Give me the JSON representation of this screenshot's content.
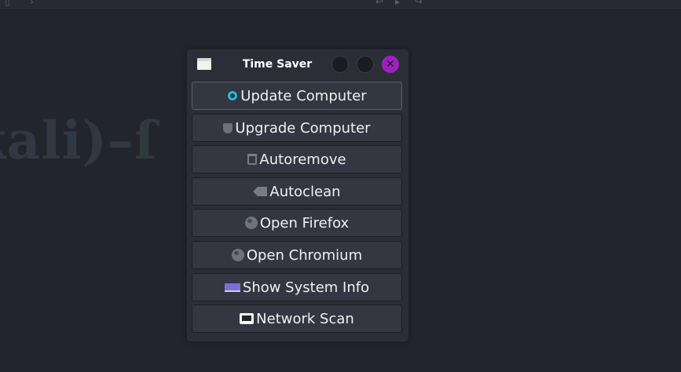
{
  "window": {
    "title": "Time Saver",
    "close_glyph": "✕"
  },
  "buttons": [
    {
      "label": "Update Computer",
      "icon": "update-icon"
    },
    {
      "label": "Upgrade Computer",
      "icon": "shield-icon"
    },
    {
      "label": "Autoremove",
      "icon": "trash-icon"
    },
    {
      "label": "Autoclean",
      "icon": "eraser-icon"
    },
    {
      "label": "Open Firefox",
      "icon": "globe-icon"
    },
    {
      "label": "Open Chromium",
      "icon": "globe-icon"
    },
    {
      "label": "Show System Info",
      "icon": "laptop-icon"
    },
    {
      "label": "Network Scan",
      "icon": "monitor-icon"
    }
  ],
  "colors": {
    "desktop": "#23252e",
    "window": "#2b2e37",
    "button": "#343742",
    "close_accent": "#a11fc2"
  }
}
